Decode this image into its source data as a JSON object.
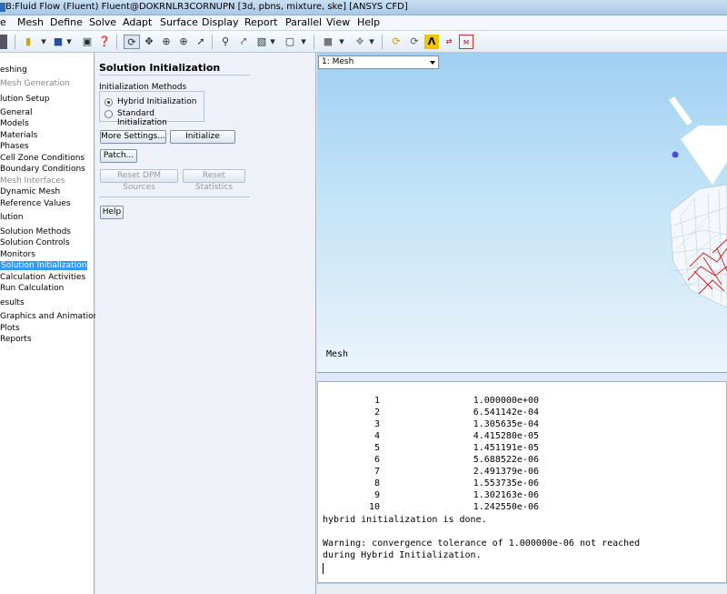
{
  "window": {
    "title": "B:Fluid Flow (Fluent) Fluent@DOKRNLR3CORNUPN  [3d, pbns, mixture, ske] [ANSYS CFD]"
  },
  "menu": [
    "e",
    "Mesh",
    "Define",
    "Solve",
    "Adapt",
    "Surface",
    "Display",
    "Report",
    "Parallel",
    "View",
    "Help"
  ],
  "toolbar": {
    "icons": [
      "new-icon",
      "open-icon",
      "save-icon",
      "print-icon",
      "help-icon",
      "rotate-icon",
      "pan-icon",
      "zoom-in-icon",
      "zoom-fit-icon",
      "probe-icon",
      "zoom-box-icon",
      "axes-icon",
      "view-icon",
      "window-icon",
      "display-icon",
      "lights-icon",
      "refresh-icon",
      "render-icon",
      "ansys-icon",
      "color-map-icon"
    ]
  },
  "tree": {
    "items": [
      {
        "label": "eshing",
        "level": 0,
        "state": "normal"
      },
      {
        "label": "Mesh Generation",
        "level": 1,
        "state": "disabled"
      },
      {
        "label": "lution Setup",
        "level": 0,
        "state": "normal"
      },
      {
        "label": "General",
        "level": 1,
        "state": "normal"
      },
      {
        "label": "Models",
        "level": 1,
        "state": "normal"
      },
      {
        "label": "Materials",
        "level": 1,
        "state": "normal"
      },
      {
        "label": "Phases",
        "level": 1,
        "state": "normal"
      },
      {
        "label": "Cell Zone Conditions",
        "level": 1,
        "state": "normal"
      },
      {
        "label": "Boundary Conditions",
        "level": 1,
        "state": "normal"
      },
      {
        "label": "Mesh Interfaces",
        "level": 1,
        "state": "disabled"
      },
      {
        "label": "Dynamic Mesh",
        "level": 1,
        "state": "normal"
      },
      {
        "label": "Reference Values",
        "level": 1,
        "state": "normal"
      },
      {
        "label": "lution",
        "level": 0,
        "state": "normal"
      },
      {
        "label": "Solution Methods",
        "level": 1,
        "state": "normal"
      },
      {
        "label": "Solution Controls",
        "level": 1,
        "state": "normal"
      },
      {
        "label": "Monitors",
        "level": 1,
        "state": "normal"
      },
      {
        "label": "Solution Initialization",
        "level": 1,
        "state": "selected"
      },
      {
        "label": "Calculation Activities",
        "level": 1,
        "state": "normal"
      },
      {
        "label": "Run Calculation",
        "level": 1,
        "state": "normal"
      },
      {
        "label": "esults",
        "level": 0,
        "state": "normal"
      },
      {
        "label": "Graphics and Animations",
        "level": 1,
        "state": "normal"
      },
      {
        "label": "Plots",
        "level": 1,
        "state": "normal"
      },
      {
        "label": "Reports",
        "level": 1,
        "state": "normal"
      }
    ]
  },
  "panel": {
    "title": "Solution Initialization",
    "methods_label": "Initialization Methods",
    "hybrid_label": "Hybrid  Initialization",
    "standard_label": "Standard Initialization",
    "selected_method": "hybrid",
    "more_settings": "More Settings...",
    "initialize": "Initialize",
    "patch": "Patch...",
    "reset_dpm": "Reset DPM Sources",
    "reset_stats": "Reset Statistics",
    "help": "Help"
  },
  "graphics": {
    "window_select": "1: Mesh",
    "mesh_label": "Mesh"
  },
  "console": {
    "iterations": [
      {
        "iter": "1",
        "value": "1.000000e+00"
      },
      {
        "iter": "2",
        "value": "6.541142e-04"
      },
      {
        "iter": "3",
        "value": "1.305635e-04"
      },
      {
        "iter": "4",
        "value": "4.415280e-05"
      },
      {
        "iter": "5",
        "value": "1.451191e-05"
      },
      {
        "iter": "6",
        "value": "5.688522e-06"
      },
      {
        "iter": "7",
        "value": "2.491379e-06"
      },
      {
        "iter": "8",
        "value": "1.553735e-06"
      },
      {
        "iter": "9",
        "value": "1.302163e-06"
      },
      {
        "iter": "10",
        "value": "1.242550e-06"
      }
    ],
    "done": "hybrid initialization is done.",
    "warning1": "Warning: convergence tolerance of 1.000000e-06 not reached",
    "warning2": "during Hybrid Initialization."
  },
  "colors": {
    "selection": "#3399ff",
    "mesh_white": "#ffffff",
    "mesh_red": "#dd1111"
  }
}
